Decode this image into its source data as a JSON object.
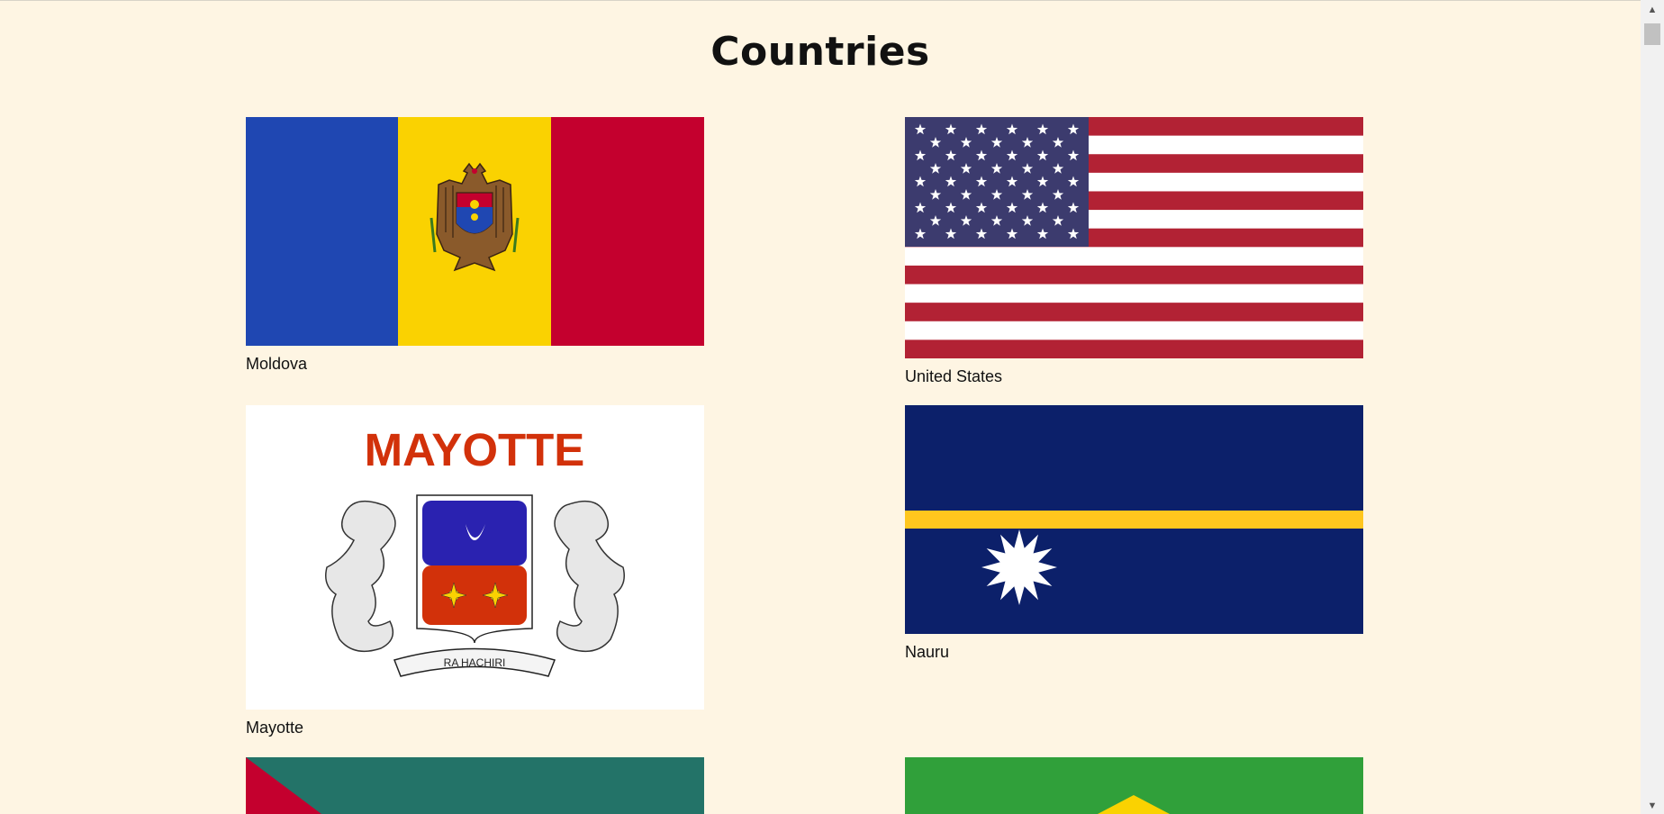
{
  "page": {
    "title": "Countries"
  },
  "countries": [
    {
      "name": "Moldova"
    },
    {
      "name": "United States"
    },
    {
      "name": "Mayotte"
    },
    {
      "name": "Nauru"
    }
  ],
  "flag_text": {
    "mayotte_title": "MAYOTTE",
    "mayotte_motto": "RA HACHIRI"
  },
  "scrollbar": {
    "up": "▲",
    "down": "▼"
  },
  "colors": {
    "background": "#fef5e3",
    "moldova_blue": "#1f47b2",
    "moldova_yellow": "#fad201",
    "moldova_red": "#c4002e",
    "us_red": "#b22234",
    "us_blue": "#3c3b6e",
    "mayotte_red": "#d2310a",
    "mayotte_blue": "#2a22b0",
    "nauru_blue": "#0c206a",
    "nauru_yellow": "#ffc61e",
    "teal": "#237368",
    "brazil_green": "#30a03a"
  }
}
